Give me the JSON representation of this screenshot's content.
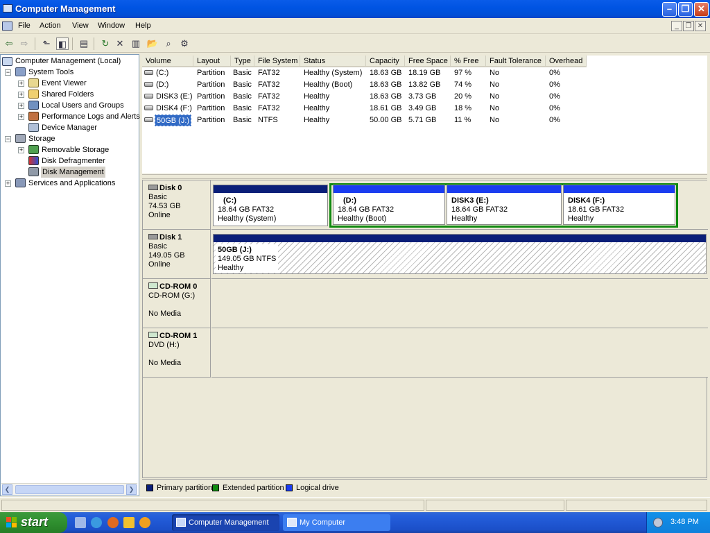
{
  "window": {
    "title": "Computer Management"
  },
  "menu": [
    "File",
    "Action",
    "View",
    "Window",
    "Help"
  ],
  "tree": {
    "root": "Computer Management (Local)",
    "system_tools": "System Tools",
    "event_viewer": "Event Viewer",
    "shared_folders": "Shared Folders",
    "local_users": "Local Users and Groups",
    "perf_logs": "Performance Logs and Alerts",
    "device_manager": "Device Manager",
    "storage": "Storage",
    "removable_storage": "Removable Storage",
    "disk_defragmenter": "Disk Defragmenter",
    "disk_management": "Disk Management",
    "services_apps": "Services and Applications"
  },
  "volume_table": {
    "columns": [
      "Volume",
      "Layout",
      "Type",
      "File System",
      "Status",
      "Capacity",
      "Free Space",
      "% Free",
      "Fault Tolerance",
      "Overhead"
    ],
    "rows": [
      [
        "(C:)",
        "Partition",
        "Basic",
        "FAT32",
        "Healthy (System)",
        "18.63 GB",
        "18.19 GB",
        "97 %",
        "No",
        "0%"
      ],
      [
        "(D:)",
        "Partition",
        "Basic",
        "FAT32",
        "Healthy (Boot)",
        "18.63 GB",
        "13.82 GB",
        "74 %",
        "No",
        "0%"
      ],
      [
        "DISK3 (E:)",
        "Partition",
        "Basic",
        "FAT32",
        "Healthy",
        "18.63 GB",
        "3.73 GB",
        "20 %",
        "No",
        "0%"
      ],
      [
        "DISK4 (F:)",
        "Partition",
        "Basic",
        "FAT32",
        "Healthy",
        "18.61 GB",
        "3.49 GB",
        "18 %",
        "No",
        "0%"
      ],
      [
        "50GB (J:)",
        "Partition",
        "Basic",
        "NTFS",
        "Healthy",
        "50.00 GB",
        "5.71 GB",
        "11 %",
        "No",
        "0%"
      ]
    ]
  },
  "disks": {
    "disk0": {
      "name": "Disk 0",
      "type": "Basic",
      "size": "74.53 GB",
      "status": "Online"
    },
    "disk1": {
      "name": "Disk 1",
      "type": "Basic",
      "size": "149.05 GB",
      "status": "Online"
    },
    "cdrom0": {
      "name": "CD-ROM 0",
      "type": "CD-ROM (G:)",
      "status": "No Media"
    },
    "cdrom1": {
      "name": "CD-ROM 1",
      "type": "DVD (H:)",
      "status": "No Media"
    }
  },
  "partitions": {
    "c": {
      "name": "(C:)",
      "size": "18.64 GB FAT32",
      "status": "Healthy (System)"
    },
    "d": {
      "name": "(D:)",
      "size": "18.64 GB FAT32",
      "status": "Healthy (Boot)"
    },
    "e": {
      "name": "DISK3  (E:)",
      "size": "18.64 GB FAT32",
      "status": "Healthy"
    },
    "f": {
      "name": "DISK4  (F:)",
      "size": "18.61 GB FAT32",
      "status": "Healthy"
    },
    "j": {
      "name": "50GB  (J:)",
      "size": "149.05 GB NTFS",
      "status": "Healthy"
    }
  },
  "legend": {
    "primary": "Primary partition",
    "extended": "Extended partition",
    "logical": "Logical drive",
    "colors": {
      "primary": "#0a1e78",
      "extended": "#108a10",
      "logical": "#1a3cf0"
    }
  },
  "taskbar": {
    "start": "start",
    "tasks": [
      "Computer Management",
      "My Computer"
    ],
    "clock": "3:48 PM"
  }
}
